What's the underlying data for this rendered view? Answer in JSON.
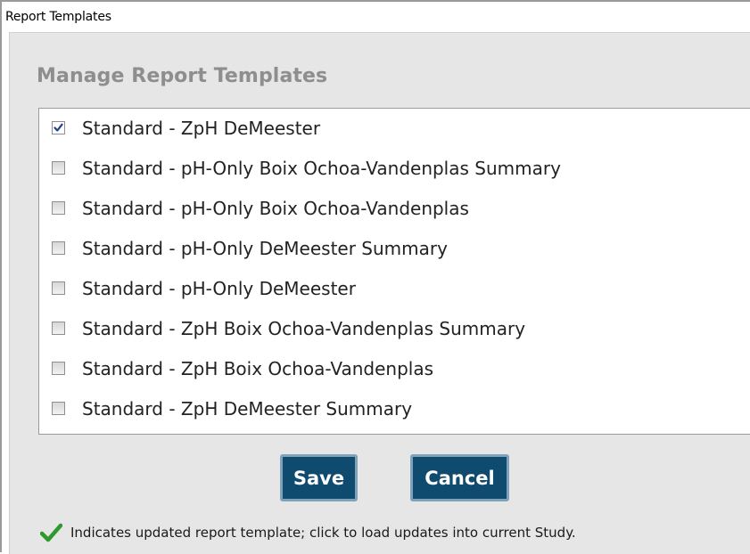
{
  "window": {
    "title": "Report Templates"
  },
  "dialog": {
    "heading": "Manage Report Templates",
    "templates": [
      {
        "label": "Standard - ZpH DeMeester",
        "checked": true
      },
      {
        "label": "Standard - pH-Only Boix Ochoa-Vandenplas Summary",
        "checked": false
      },
      {
        "label": "Standard - pH-Only Boix Ochoa-Vandenplas",
        "checked": false
      },
      {
        "label": "Standard - pH-Only DeMeester Summary",
        "checked": false
      },
      {
        "label": "Standard - pH-Only DeMeester",
        "checked": false
      },
      {
        "label": "Standard - ZpH Boix Ochoa-Vandenplas Summary",
        "checked": false
      },
      {
        "label": "Standard - ZpH Boix Ochoa-Vandenplas",
        "checked": false
      },
      {
        "label": "Standard - ZpH DeMeester Summary",
        "checked": false
      }
    ],
    "save_label": "Save",
    "cancel_label": "Cancel",
    "footnote": {
      "icon": "green-checkmark-icon",
      "text": "Indicates updated report template; click to load updates into current Study."
    }
  },
  "colors": {
    "button_bg": "#0f4a6f",
    "button_border": "#7ea2ba",
    "heading": "#8e8e8e",
    "dialog_bg": "#e6e6e6",
    "checkmark_green": "#2e9a2e",
    "checkbox_tick": "#1f3f8f"
  }
}
